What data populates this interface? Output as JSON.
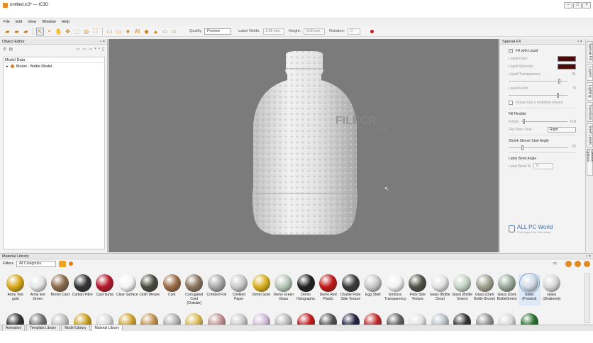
{
  "window": {
    "title": "untitled.ic3* — IC3D"
  },
  "menu": [
    "File",
    "Edit",
    "View",
    "Window",
    "Help"
  ],
  "toolbar": {
    "quality_label": "Quality",
    "quality_value": "Preview",
    "label_width_label": "Label Width:",
    "label_width_value": "5.00 mm",
    "height_label": "Height:",
    "height_value": "5.00 mm",
    "rotation_label": "Rotation:",
    "rotation_value": "0"
  },
  "object_editor": {
    "title": "Object Editor",
    "header": "Model Data",
    "tree": [
      {
        "label": "Model - Bottle Model"
      }
    ]
  },
  "special_fx": {
    "title": "Special FX",
    "fill_with_liquid": "Fill with Liquid",
    "liquid_color": "Liquid Color",
    "liquid_specular": "Liquid Specular",
    "liquid_transparency": "Liquid Transparency",
    "liquid_transparency_value": "81",
    "liquid_level": "Liquid Level",
    "liquid_level_value": "79",
    "vessel_interior": "Vessel has a modelled interior",
    "fill_flexible": "Fill Flexible",
    "empty": "Empty",
    "full": "Full",
    "flip_riser_seal": "Flip Riser Seal",
    "flip_riser_value": "Right",
    "shrink_sleeve": "Shrink Sleeve Start Angle",
    "shrink_value": "65",
    "label_bend_angle": "Label Bend Angle",
    "label_bend_pct": "Label Bend %",
    "label_bend_value": "0",
    "colors": {
      "liquid": "#4a0b0b"
    }
  },
  "side_tabs": [
    "Special FX",
    "Layers",
    "Lighting",
    "Transform",
    "Shelf Labels",
    "Cartoon Options"
  ],
  "material_library": {
    "title": "Material Library",
    "filters_label": "Filters",
    "filter_value": "All Categories",
    "materials": [
      {
        "name": "Army Test gold",
        "color": "#d8a818"
      },
      {
        "name": "Army test Green",
        "color": "#e6e6e6"
      },
      {
        "name": "Brown Card",
        "color": "#8a6a4a"
      },
      {
        "name": "Carbon Fibre",
        "color": "#333333"
      },
      {
        "name": "Card bump",
        "color": "#b5182a"
      },
      {
        "name": "Clear Surface",
        "color": "#f4f4f4"
      },
      {
        "name": "Cloth Weave",
        "color": "#4a4a40"
      },
      {
        "name": "Cork",
        "color": "#9b6b45"
      },
      {
        "name": "Corrugated Card (Outside)",
        "color": "#8a7560"
      },
      {
        "name": "Crinkled Foil",
        "color": "#a8a8a8"
      },
      {
        "name": "Crinkled Paper",
        "color": "#c8c8c8"
      },
      {
        "name": "Demo Gold",
        "color": "#d8b020"
      },
      {
        "name": "Demo Green Glass",
        "color": "#b8c8b8"
      },
      {
        "name": "Demo Holographic",
        "color": "#202020"
      },
      {
        "name": "Demo Red Plastic",
        "color": "#c01818"
      },
      {
        "name": "Double Flute Side Texture",
        "color": "#3a3a3a"
      },
      {
        "name": "Egg Shell",
        "color": "#c8c8c8"
      },
      {
        "name": "Emboss Transparency",
        "color": "#f2f2f2"
      },
      {
        "name": "Flute Side Texture",
        "color": "#505048"
      },
      {
        "name": "Glass (Bottle Clear)",
        "color": "#e2e2e2"
      },
      {
        "name": "Glass (Bottle Green)",
        "color": "#c4d4c4"
      },
      {
        "name": "Glass (Dark Bottle Brown)",
        "color": "#a0a090"
      },
      {
        "name": "Glass (Dark BottleGreen)",
        "color": "#98a898"
      },
      {
        "name": "Glass (Frosted)",
        "color": "#d0dae6"
      },
      {
        "name": "Glass (Shattered)",
        "color": "#d8d8d8"
      }
    ],
    "row2_colors": [
      "#303030",
      "#707070",
      "#c0c0c0",
      "#c8a020",
      "#d8d8d8",
      "#d0a030",
      "#c09050",
      "#b0b0b0",
      "#d8b850",
      "#c09090",
      "#c8c8c8",
      "#d0b8d8",
      "#b8b8b8",
      "#c01818",
      "#505050",
      "#202040",
      "#c02828",
      "#606060",
      "#e0e0e0",
      "#b8c0c8",
      "#303030",
      "#909090",
      "#d8d8d8",
      "#287030"
    ]
  },
  "bottom_tabs": [
    "Animation",
    "Template Library",
    "Model Library",
    "Material Library"
  ],
  "watermarks": {
    "filecr": "FILECR",
    "filecr_com": ".com",
    "allpc": "ALL PC World",
    "allpc_sub": "Free Apps One Click Away"
  }
}
